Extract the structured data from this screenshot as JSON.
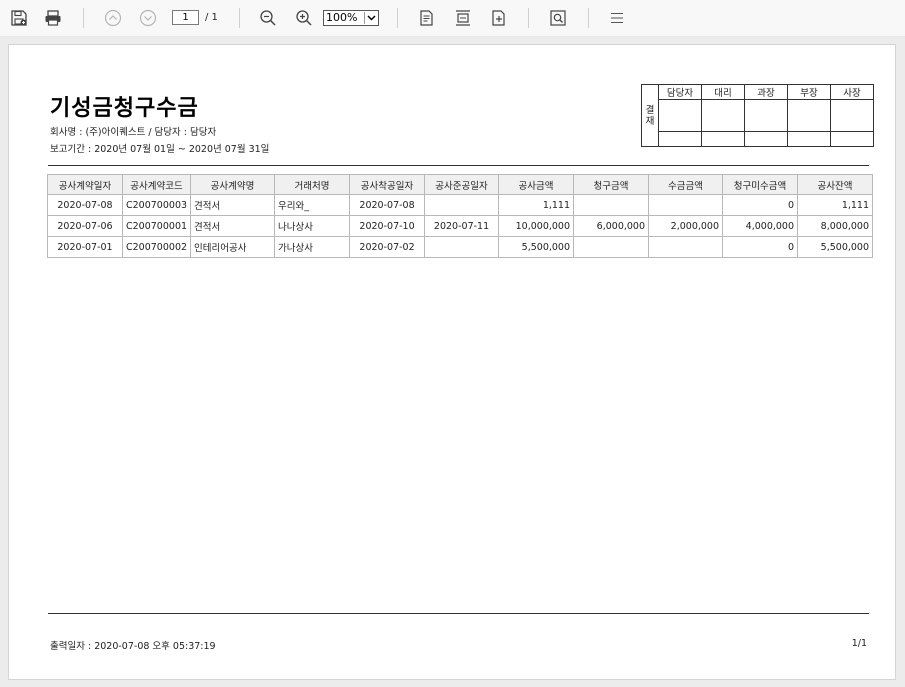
{
  "toolbar": {
    "icons": {
      "save": "save-icon",
      "print": "print-icon",
      "prev": "page-up-icon",
      "next": "page-down-icon",
      "zoom_out": "zoom-out-icon",
      "zoom_in": "zoom-in-icon",
      "export": "export-document-icon",
      "page_setup": "page-setup-icon",
      "fit": "fit-page-icon",
      "find": "find-icon",
      "menu": "hamburger-menu-icon"
    },
    "page_current": "1",
    "page_total": "/ 1",
    "zoom": "100%"
  },
  "report": {
    "title": "기성금청구수금",
    "company_line": "회사명 : (주)아이퀘스트 / 담당자 : 담당자",
    "period_line": "보고기간 : 2020년 07월 01일  ~ 2020년 07월 31일",
    "approval": {
      "label": "결\n재",
      "roles": [
        "담당자",
        "대리",
        "과장",
        "부장",
        "사장"
      ]
    },
    "columns": [
      "공사계약일자",
      "공사계약코드",
      "공사계약명",
      "거래처명",
      "공사착공일자",
      "공사준공일자",
      "공사금액",
      "청구금액",
      "수금금액",
      "청구미수금액",
      "공사잔액"
    ],
    "rows": [
      {
        "contract_date": "2020-07-08",
        "code": "C200700003",
        "name": "견적서",
        "client": "우리와_",
        "start": "2020-07-08",
        "end": "",
        "amount": "1,111",
        "billed": "",
        "collected": "",
        "receivable": "0",
        "balance": "1,111"
      },
      {
        "contract_date": "2020-07-06",
        "code": "C200700001",
        "name": "견적서",
        "client": "나나상사",
        "start": "2020-07-10",
        "end": "2020-07-11",
        "amount": "10,000,000",
        "billed": "6,000,000",
        "collected": "2,000,000",
        "receivable": "4,000,000",
        "balance": "8,000,000"
      },
      {
        "contract_date": "2020-07-01",
        "code": "C200700002",
        "name": "인테리어공사",
        "client": "가나상사",
        "start": "2020-07-02",
        "end": "",
        "amount": "5,500,000",
        "billed": "",
        "collected": "",
        "receivable": "0",
        "balance": "5,500,000"
      }
    ],
    "print_date": "출력일자 : 2020-07-08   오후  05:37:19",
    "page_no": "1/1"
  }
}
